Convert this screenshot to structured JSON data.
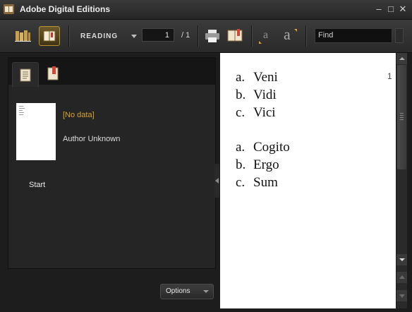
{
  "window": {
    "title": "Adobe Digital Editions"
  },
  "toolbar": {
    "view_label": "READING",
    "page_current": "1",
    "page_total": "/ 1",
    "find_text": "Find",
    "font_small_glyph": "a",
    "font_large_glyph": "a"
  },
  "sidebar": {
    "book_title": "[No data]",
    "author": "Author Unknown",
    "toc_item": "Start",
    "options_label": "Options"
  },
  "document": {
    "page_number": "1",
    "lists": [
      [
        {
          "marker": "a.",
          "text": "Veni"
        },
        {
          "marker": "b.",
          "text": "Vidi"
        },
        {
          "marker": "c.",
          "text": "Vici"
        }
      ],
      [
        {
          "marker": "a.",
          "text": "Cogito"
        },
        {
          "marker": "b.",
          "text": "Ergo"
        },
        {
          "marker": "c.",
          "text": "Sum"
        }
      ]
    ]
  },
  "colors": {
    "accent": "#d9a230",
    "chrome_dark": "#1c1c1c",
    "page": "#ffffff"
  }
}
